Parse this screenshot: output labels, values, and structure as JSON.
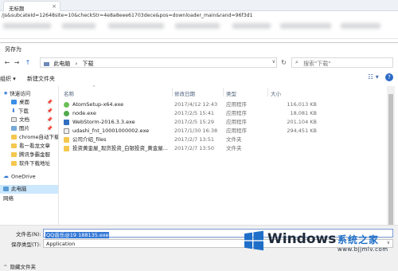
{
  "browser": {
    "tab_title": "无标题",
    "tab_close": "×",
    "address_text": "/js&subcateId=12648site=10&checkStr=4e8a8eee61703dece&pos=downloader_main&rand=96f3d1"
  },
  "dialog": {
    "title": "另存为",
    "nav": {
      "back": "←",
      "forward": "→",
      "up": "↑",
      "path": [
        "此电脑",
        "下载"
      ],
      "path_sep": "›",
      "dropdown": "∨",
      "refresh": "↻",
      "search_placeholder": "搜索\"下载\"",
      "search_glyph": "⌕"
    },
    "toolbar": {
      "organize": "组织 ▾",
      "new_folder": "新建文件夹",
      "view": "☷ ▾",
      "help": "?"
    },
    "sidebar": {
      "items": [
        {
          "label": "快速访问",
          "icon": "star-icon",
          "glyph": "★",
          "level": 0
        },
        {
          "label": "桌面",
          "icon": "desktop-icon",
          "level": 1,
          "pinned": true
        },
        {
          "label": "下载",
          "icon": "download-icon",
          "glyph": "⬇",
          "level": 1,
          "pinned": true
        },
        {
          "label": "文档",
          "icon": "document-icon",
          "level": 1,
          "pinned": true
        },
        {
          "label": "图片",
          "icon": "picture-icon",
          "level": 1,
          "pinned": true
        },
        {
          "label": "chrome自动下载",
          "icon": "folder-icon",
          "level": 1
        },
        {
          "label": "看一看龙文章",
          "icon": "folder-icon",
          "level": 1
        },
        {
          "label": "腾讯争霸金服",
          "icon": "folder-icon",
          "level": 1
        },
        {
          "label": "软件下载地址",
          "icon": "folder-icon",
          "level": 1
        },
        {
          "label": "OneDrive",
          "icon": "cloud-icon",
          "glyph": "☁",
          "level": 0
        },
        {
          "label": "此电脑",
          "icon": "computer-icon",
          "level": 0,
          "selected": true
        }
      ],
      "pin_glyph": "📌",
      "tail_label": "网络"
    },
    "columns": {
      "name": "名称",
      "date": "修改日期",
      "type": "类型",
      "size": "大小",
      "sort_glyph": "^"
    },
    "files": [
      {
        "name": "AtomSetup-x64.exe",
        "date": "2017/4/12 12:43",
        "type": "应用程序",
        "size": "116,013 KB",
        "icon": "atom-app-icon"
      },
      {
        "name": "node.exe",
        "date": "2017/2/5 15:41",
        "type": "应用程序",
        "size": "18,081 KB",
        "icon": "node-app-icon"
      },
      {
        "name": "WebStorm-2016.3.3.exe",
        "date": "2017/2/5 15:29",
        "type": "应用程序",
        "size": "201,104 KB",
        "icon": "webstorm-app-icon"
      },
      {
        "name": "udashi_fnt_10001000002.exe",
        "date": "2017/1/30 16:38",
        "type": "应用程序",
        "size": "294,451 KB",
        "icon": "installer-icon"
      },
      {
        "name": "公司介绍_files",
        "date": "2017/2/7 13:51",
        "type": "文件夹",
        "size": "",
        "icon": "folder-icon"
      },
      {
        "name": "投资黄金屋_现货投资_白银投资_黄金屋...",
        "date": "2017/2/7 13:50",
        "type": "文件夹",
        "size": "",
        "icon": "folder-icon"
      }
    ],
    "form": {
      "filename_label": "文件名(N):",
      "filename_value": "QQ音乐@19 188135.exe",
      "savetype_label": "保存类型(T):",
      "savetype_value": "Application",
      "savetype_dd": "∨",
      "hide_folders": "隐藏文件夹",
      "hide_caret": "^"
    }
  },
  "watermark": {
    "brand": "Windows",
    "cn": "系统之家",
    "url": "www.bjjmlv.com"
  }
}
